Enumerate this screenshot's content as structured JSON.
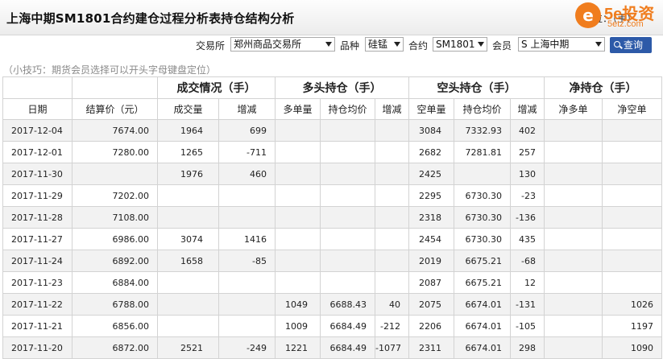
{
  "header": {
    "title": "上海中期SM1801合约建仓过程分析表持仓结构分析",
    "unit": "单位：（手）",
    "logo_text": "5e投资",
    "logo_site": "5etz.com",
    "logo_mark": "e"
  },
  "filters": {
    "exchange_label": "交易所",
    "exchange_value": "郑州商品交易所",
    "variety_label": "品种",
    "variety_value": "硅锰",
    "contract_label": "合约",
    "contract_value": "SM1801",
    "member_label": "会员",
    "member_value": "S 上海中期",
    "query_label": "查询"
  },
  "tip": "（小技巧：期货会员选择可以开头字母键盘定位）",
  "table": {
    "groups": [
      "成交情况（手）",
      "多头持仓（手）",
      "空头持仓（手）",
      "净持仓（手）"
    ],
    "columns": [
      "日期",
      "结算价（元）",
      "成交量",
      "增减",
      "多单量",
      "持仓均价",
      "增减",
      "空单量",
      "持仓均价",
      "增减",
      "净多单",
      "净空单"
    ],
    "rows": [
      [
        "2017-12-04",
        "7674.00",
        "1964",
        "699",
        "",
        "",
        "",
        "3084",
        "7332.93",
        "402",
        "",
        ""
      ],
      [
        "2017-12-01",
        "7280.00",
        "1265",
        "-711",
        "",
        "",
        "",
        "2682",
        "7281.81",
        "257",
        "",
        ""
      ],
      [
        "2017-11-30",
        "",
        "1976",
        "460",
        "",
        "",
        "",
        "2425",
        "",
        "130",
        "",
        ""
      ],
      [
        "2017-11-29",
        "7202.00",
        "",
        "",
        "",
        "",
        "",
        "2295",
        "6730.30",
        "-23",
        "",
        ""
      ],
      [
        "2017-11-28",
        "7108.00",
        "",
        "",
        "",
        "",
        "",
        "2318",
        "6730.30",
        "-136",
        "",
        ""
      ],
      [
        "2017-11-27",
        "6986.00",
        "3074",
        "1416",
        "",
        "",
        "",
        "2454",
        "6730.30",
        "435",
        "",
        ""
      ],
      [
        "2017-11-24",
        "6892.00",
        "1658",
        "-85",
        "",
        "",
        "",
        "2019",
        "6675.21",
        "-68",
        "",
        ""
      ],
      [
        "2017-11-23",
        "6884.00",
        "",
        "",
        "",
        "",
        "",
        "2087",
        "6675.21",
        "12",
        "",
        ""
      ],
      [
        "2017-11-22",
        "6788.00",
        "",
        "",
        "1049",
        "6688.43",
        "40",
        "2075",
        "6674.01",
        "-131",
        "",
        "1026"
      ],
      [
        "2017-11-21",
        "6856.00",
        "",
        "",
        "1009",
        "6684.49",
        "-212",
        "2206",
        "6674.01",
        "-105",
        "",
        "1197"
      ],
      [
        "2017-11-20",
        "6872.00",
        "2521",
        "-249",
        "1221",
        "6684.49",
        "-1077",
        "2311",
        "6674.01",
        "298",
        "",
        "1090"
      ]
    ]
  }
}
